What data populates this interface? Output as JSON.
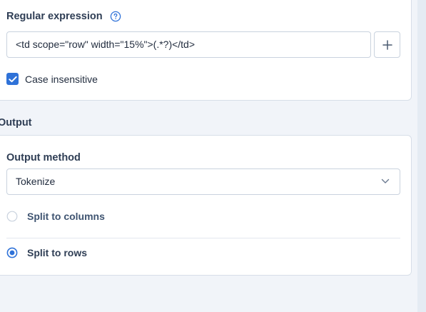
{
  "regex_section": {
    "label": "Regular expression",
    "help_icon": "help-circle-icon",
    "input_value": "<td scope=\"row\" width=\"15%\">(.*?)</td>",
    "add_icon": "plus-icon",
    "case_insensitive": {
      "label": "Case insensitive",
      "checked": true
    }
  },
  "output_section": {
    "title": "Output",
    "method_label": "Output method",
    "method_value": "Tokenize",
    "options": [
      {
        "label": "Split to columns",
        "selected": false
      },
      {
        "label": "Split to rows",
        "selected": true
      }
    ]
  },
  "colors": {
    "accent": "#2f72d8",
    "background": "#f1f4f9",
    "card": "#ffffff",
    "border": "#d7dee8"
  }
}
